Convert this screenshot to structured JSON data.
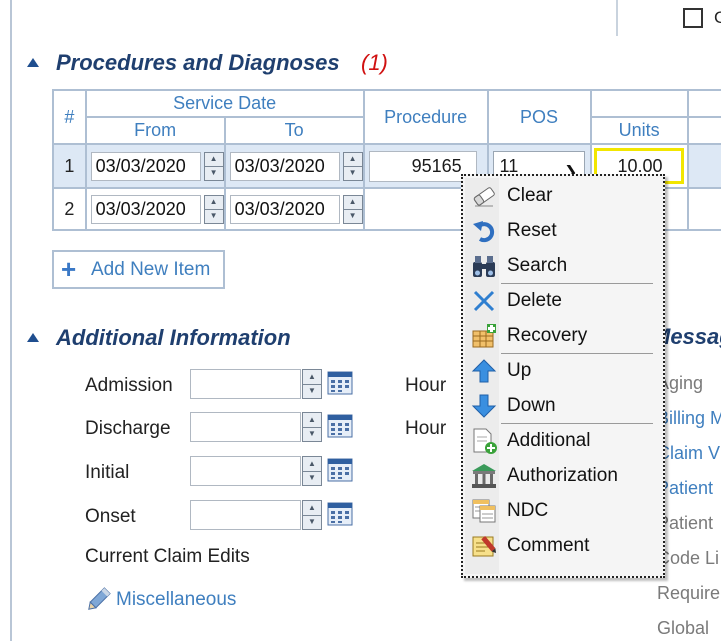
{
  "top_right": {
    "checkbox_tail": "C"
  },
  "procedures": {
    "title": "Procedures and Diagnoses",
    "count": "(1)",
    "headers": {
      "num": "#",
      "service_date": "Service Date",
      "from": "From",
      "to": "To",
      "procedure": "Procedure",
      "pos": "POS",
      "units": "Units"
    },
    "rows": [
      {
        "num": "1",
        "from": "03/03/2020",
        "to": "03/03/2020",
        "procedure": "95165",
        "pos": "11",
        "units": "10.00"
      },
      {
        "num": "2",
        "from": "03/03/2020",
        "to": "03/03/2020",
        "procedure": "",
        "pos": "",
        "units": ""
      }
    ],
    "add_item": "Add New Item"
  },
  "additional": {
    "title": "Additional Information",
    "fields": [
      "Admission",
      "Discharge",
      "Initial",
      "Onset"
    ],
    "hour_labels": [
      "Hour",
      "Hour"
    ],
    "current_claim_edits": "Current Claim Edits",
    "misc_link": "Miscellaneous"
  },
  "messages": {
    "title": "Messag",
    "items": [
      "Aging",
      "Billing M",
      "Claim V",
      "Patient",
      "Patient",
      "Code Li",
      "Require",
      "Global"
    ]
  },
  "context_menu": {
    "items": [
      {
        "label": "Clear",
        "icon": "eraser-icon"
      },
      {
        "label": "Reset",
        "icon": "undo-icon"
      },
      {
        "label": "Search",
        "icon": "binoculars-icon"
      },
      {
        "label": "Delete",
        "icon": "x-delete-icon"
      },
      {
        "label": "Recovery",
        "icon": "recovery-grid-icon"
      },
      {
        "label": "Up",
        "icon": "arrow-up-icon"
      },
      {
        "label": "Down",
        "icon": "arrow-down-icon"
      },
      {
        "label": "Additional",
        "icon": "add-document-icon"
      },
      {
        "label": "Authorization",
        "icon": "bank-building-icon"
      },
      {
        "label": "NDC",
        "icon": "ndc-table-icon"
      },
      {
        "label": "Comment",
        "icon": "comment-note-icon"
      }
    ]
  },
  "colors": {
    "accent": "#3f7fbf",
    "title": "#1f3f6f",
    "count": "#d01010",
    "highlight": "#f2e600"
  }
}
